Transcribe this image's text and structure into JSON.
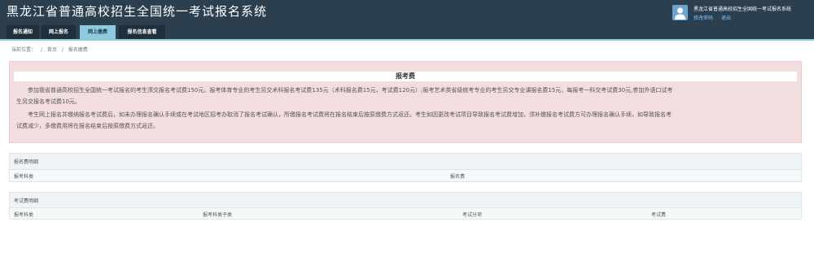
{
  "header": {
    "app_title": "黑龙江省普通高校招生全国统一考试报名系统",
    "system_name": "黑龙江省普通高校招生全国统一考试报名系统",
    "change_password": "修改密码",
    "logout": "退出"
  },
  "tabs": [
    {
      "label": "报名通知",
      "active": false
    },
    {
      "label": "网上报名",
      "active": false
    },
    {
      "label": "网上缴费",
      "active": true
    },
    {
      "label": "报名信息查看",
      "active": false
    }
  ],
  "breadcrumb": {
    "prefix": "当前位置：",
    "sep": "/",
    "home": "首页",
    "current": "报名缴费"
  },
  "fee_notice": {
    "title": "报考费",
    "lines": [
      "参加我省普通高校招生全国统一考试报名的考生须交报名考试费150元。报考体育专业的考生另交术科报名考试费135元（术科报名费15元，考试费120元）;报考艺术类省级统考专业的考生另交专业课报名费15元，每报考一科交考试费30元,参加外语口试考",
      "生另交报名考试费10元。",
      "考生网上报名并缴纳报名考试费后，如未办理报名确认手续或在考试地区招考办取消了报名考试确认，所缴报名考试费将在报名结束后按原缴费方式返还。考生如因更改考试项目导致报名考试费增加，须补缴报名考试费方可办理报名确认手续，如导致报名考",
      "试费减少，多缴费用将在报名结束后按原缴费方式返还。"
    ]
  },
  "reg_fee_detail": {
    "title": "报名费明细",
    "columns": [
      "报考科类",
      "报名费"
    ]
  },
  "exam_fee_detail": {
    "title": "考试费明细",
    "columns": [
      "报考科类",
      "报考科类子类",
      "考试分项",
      "考试费"
    ]
  },
  "colors": {
    "header_bg": "#2b3f4e",
    "active_tab": "#8fc9dd",
    "notice_bg": "#f2dede",
    "link": "#7ec4ff"
  }
}
